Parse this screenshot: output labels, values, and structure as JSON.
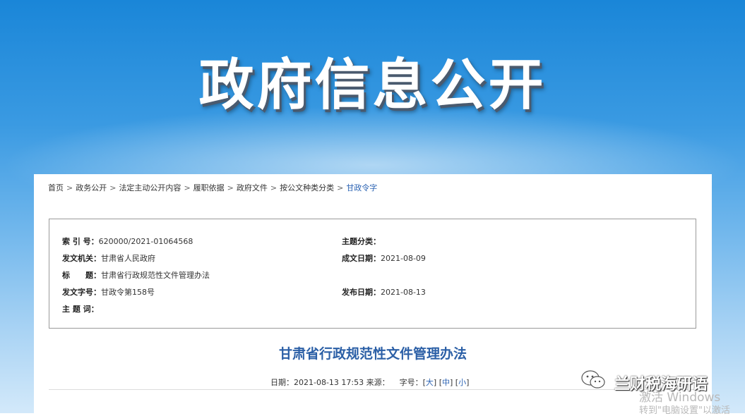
{
  "banner": {
    "title": "政府信息公开"
  },
  "breadcrumb": [
    {
      "label": "首页"
    },
    {
      "label": "政务公开"
    },
    {
      "label": "法定主动公开内容"
    },
    {
      "label": "履职依据"
    },
    {
      "label": "政府文件"
    },
    {
      "label": "按公文种类分类"
    },
    {
      "label": "甘政令字"
    }
  ],
  "breadcrumb_sep": ">",
  "meta": {
    "index_label": "索 引 号：",
    "index_value": "620000/2021-01064568",
    "topic_class_label": "主题分类：",
    "topic_class_value": "",
    "issuer_label": "发文机关：",
    "issuer_value": "甘肃省人民政府",
    "written_date_label": "成文日期：",
    "written_date_value": "2021-08-09",
    "title_label": "标　　题：",
    "title_value": "甘肃省行政规范性文件管理办法",
    "doc_no_label": "发文字号：",
    "doc_no_value": "甘政令第158号",
    "publish_date_label": "发布日期：",
    "publish_date_value": "2021-08-13",
    "keywords_label": "主 题 词：",
    "keywords_value": ""
  },
  "document": {
    "title": "甘肃省行政规范性文件管理办法",
    "date_text": "日期：2021-08-13 17:53 来源：",
    "font_label": "字号：",
    "font_large": "大",
    "font_medium": "中",
    "font_small": "小"
  },
  "watermark": {
    "text": "兰财税海研语"
  },
  "windows": {
    "line1": "激活 Windows",
    "line2": "转到\"电脑设置\"以激活"
  }
}
